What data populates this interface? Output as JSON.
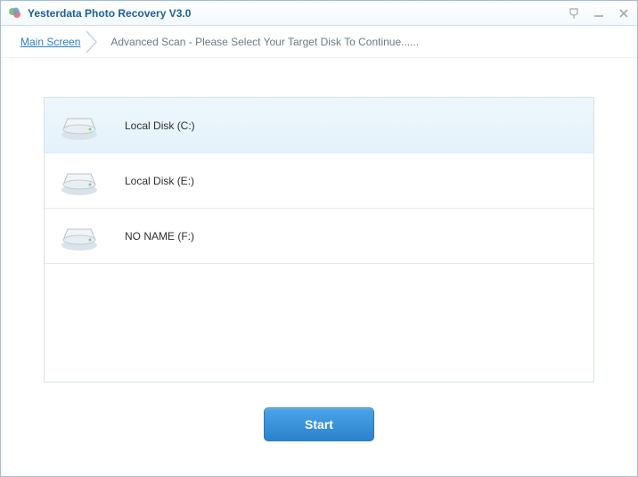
{
  "window": {
    "title": "Yesterdata Photo Recovery V3.0"
  },
  "breadcrumb": {
    "link": "Main Screen",
    "step": "Advanced Scan - Please Select Your Target Disk To Continue......"
  },
  "disks": [
    {
      "label": "Local Disk (C:)",
      "selected": true
    },
    {
      "label": "Local Disk (E:)",
      "selected": false
    },
    {
      "label": "NO NAME (F:)",
      "selected": false
    }
  ],
  "actions": {
    "start": "Start"
  }
}
